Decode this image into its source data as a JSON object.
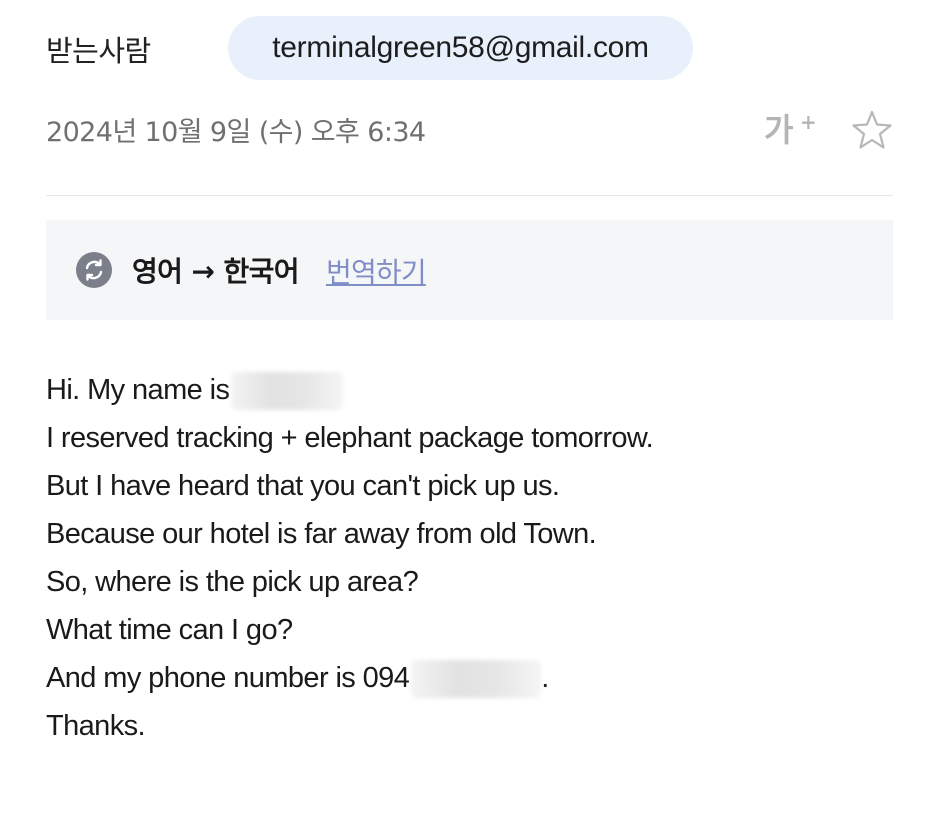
{
  "header": {
    "recipient_label": "받는사람",
    "recipient_email": "terminalgreen58@gmail.com",
    "date": "2024년 10월 9일 (수) 오후 6:34",
    "font_size_label": "가",
    "font_size_plus": "+"
  },
  "icons": {
    "star": "star-outline-icon",
    "translate": "translate-refresh-icon"
  },
  "translate_bar": {
    "languages": "영어 → 한국어",
    "action_label": "번역하기"
  },
  "colors": {
    "chip_background": "#e8f0fb",
    "translate_link": "#7f8ec6",
    "translate_bar_background": "#f5f6f8"
  },
  "message": {
    "line1_prefix": "Hi. My name is",
    "line2": "I reserved tracking + elephant package tomorrow.",
    "line3": "But I have heard that you can't pick up us.",
    "line4": "Because our hotel is far away from old Town.",
    "line5": "So, where is the pick up area?",
    "line6": "What time can I go?",
    "line7_prefix": "And my phone number is 094",
    "line7_suffix": ".",
    "line8": "Thanks."
  }
}
